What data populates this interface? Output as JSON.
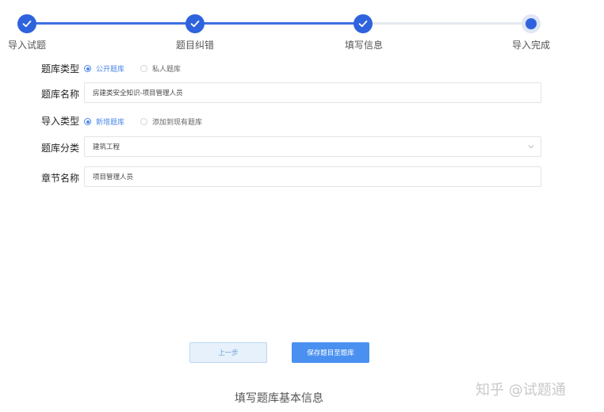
{
  "stepper": {
    "steps": [
      {
        "label": "导入试题",
        "state": "done"
      },
      {
        "label": "题目纠错",
        "state": "done"
      },
      {
        "label": "填写信息",
        "state": "done"
      },
      {
        "label": "导入完成",
        "state": "current"
      }
    ],
    "active_color": "#2f63dd"
  },
  "form": {
    "bank_type": {
      "label": "题库类型",
      "options": [
        "公开题库",
        "私人题库"
      ],
      "selected": "公开题库"
    },
    "bank_name": {
      "label": "题库名称",
      "value": "房建类安全知识-项目管理人员"
    },
    "import_type": {
      "label": "导入类型",
      "options": [
        "新增题库",
        "添加到现有题库"
      ],
      "selected": "新增题库"
    },
    "bank_category": {
      "label": "题库分类",
      "value": "建筑工程",
      "icon": "chevron-down-icon"
    },
    "chapter_name": {
      "label": "章节名称",
      "value": "项目管理人员"
    }
  },
  "buttons": {
    "prev": "上一步",
    "save": "保存题目至题库"
  },
  "caption": "填写题库基本信息",
  "watermark": "知乎 @试题通"
}
